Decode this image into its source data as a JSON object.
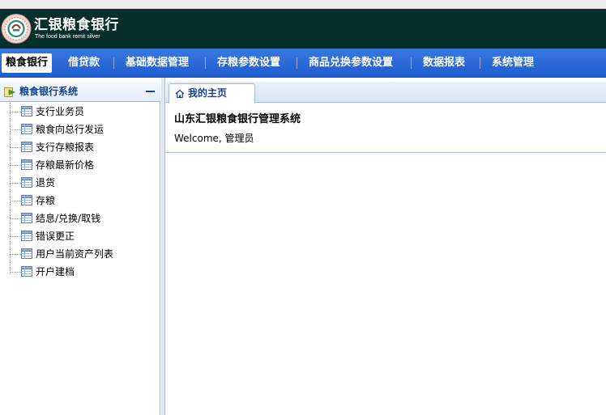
{
  "header": {
    "brand_name": "汇银粮食银行",
    "brand_subtitle": "The food bank remit silver",
    "logo_icon": "bank-seal-logo",
    "colors": {
      "header_bg": "#072f2c",
      "nav_bg": "#2a68d8",
      "accent": "#15428b"
    }
  },
  "nav": {
    "items": [
      {
        "label": "粮食银行",
        "active": true
      },
      {
        "label": "借贷款"
      },
      {
        "label": "基础数据管理"
      },
      {
        "label": "存粮参数设置"
      },
      {
        "label": "商品兑换参数设置"
      },
      {
        "label": "数据报表"
      },
      {
        "label": "系统管理"
      }
    ]
  },
  "sidebar": {
    "title": "粮食银行系统",
    "title_icon": "folder-arrow-icon",
    "collapse_icon": "minus-icon",
    "items": [
      {
        "label": "支行业务员",
        "icon": "grid-icon"
      },
      {
        "label": "粮食向总行发运",
        "icon": "grid-icon"
      },
      {
        "label": "支行存粮报表",
        "icon": "grid-icon"
      },
      {
        "label": "存粮最新价格",
        "icon": "grid-icon"
      },
      {
        "label": "退货",
        "icon": "grid-icon"
      },
      {
        "label": "存粮",
        "icon": "grid-icon"
      },
      {
        "label": "结息/兑换/取钱",
        "icon": "grid-icon"
      },
      {
        "label": "错误更正",
        "icon": "grid-icon"
      },
      {
        "label": "用户当前资产列表",
        "icon": "grid-icon"
      },
      {
        "label": "开户建档",
        "icon": "grid-icon"
      }
    ]
  },
  "main": {
    "tab_label": "我的主页",
    "tab_icon": "home-icon",
    "system_title": "山东汇银粮食银行管理系统",
    "welcome_text": "Welcome, 管理员"
  }
}
